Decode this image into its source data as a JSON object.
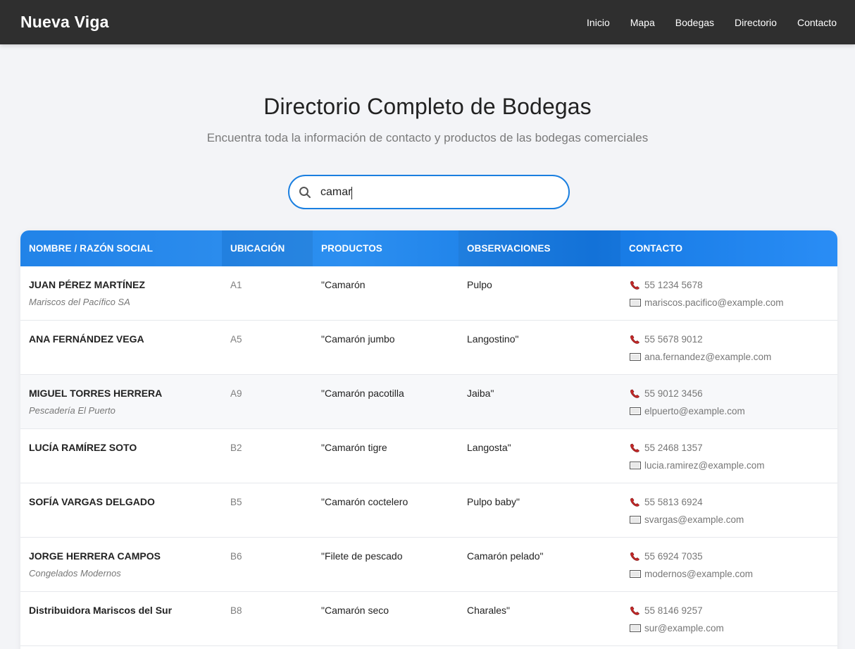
{
  "header": {
    "brand": "Nueva Viga",
    "nav": [
      "Inicio",
      "Mapa",
      "Bodegas",
      "Directorio",
      "Contacto"
    ]
  },
  "hero": {
    "title": "Directorio Completo de Bodegas",
    "subtitle": "Encuentra toda la información de contacto y productos de las bodegas comerciales"
  },
  "search": {
    "value": "camar",
    "icon": "search-icon"
  },
  "table": {
    "headers": [
      "NOMBRE / RAZÓN SOCIAL",
      "UBICACIÓN",
      "PRODUCTOS",
      "OBSERVACIONES",
      "CONTACTO"
    ],
    "rows": [
      {
        "name": "JUAN PÉREZ MARTÍNEZ",
        "company": "Mariscos del Pacífico SA",
        "location": "A1",
        "products": "\"Camarón",
        "notes": "Pulpo",
        "phone": "55 1234 5678",
        "email": "mariscos.pacifico@example.com"
      },
      {
        "name": "ANA FERNÁNDEZ VEGA",
        "company": "",
        "location": "A5",
        "products": "\"Camarón jumbo",
        "notes": "Langostino\"",
        "phone": "55 5678 9012",
        "email": "ana.fernandez@example.com"
      },
      {
        "name": "MIGUEL TORRES HERRERA",
        "company": "Pescadería El Puerto",
        "location": "A9",
        "products": "\"Camarón pacotilla",
        "notes": "Jaiba\"",
        "phone": "55 9012 3456",
        "email": "elpuerto@example.com"
      },
      {
        "name": "LUCÍA RAMÍREZ SOTO",
        "company": "",
        "location": "B2",
        "products": "\"Camarón tigre",
        "notes": "Langosta\"",
        "phone": "55 2468 1357",
        "email": "lucia.ramirez@example.com"
      },
      {
        "name": "SOFÍA VARGAS DELGADO",
        "company": "",
        "location": "B5",
        "products": "\"Camarón coctelero",
        "notes": "Pulpo baby\"",
        "phone": "55 5813 6924",
        "email": "svargas@example.com"
      },
      {
        "name": "JORGE HERRERA CAMPOS",
        "company": "Congelados Modernos",
        "location": "B6",
        "products": "\"Filete de pescado",
        "notes": "Camarón pelado\"",
        "phone": "55 6924 7035",
        "email": "modernos@example.com"
      },
      {
        "name": "Distribuidora Mariscos del Sur",
        "company": "",
        "location": "B8",
        "products": "\"Camarón seco",
        "notes": "Charales\"",
        "phone": "55 8146 9257",
        "email": "sur@example.com"
      }
    ]
  },
  "colors": {
    "topbar": "#2f2f2f",
    "accent": "#1a7fe8",
    "background": "#f3f4f7"
  }
}
